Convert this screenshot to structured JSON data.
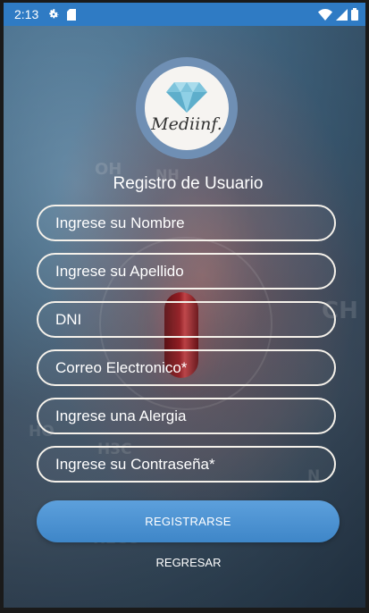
{
  "status_bar": {
    "time": "2:13"
  },
  "logo": {
    "text": "Mediinf."
  },
  "form": {
    "title": "Registro de Usuario",
    "fields": [
      {
        "name": "nombre-field",
        "placeholder": "Ingrese su Nombre",
        "value": ""
      },
      {
        "name": "apellido-field",
        "placeholder": "Ingrese su Apellido",
        "value": ""
      },
      {
        "name": "dni-field",
        "placeholder": "DNI",
        "value": ""
      },
      {
        "name": "email-field",
        "placeholder": "Correo Electronico*",
        "value": ""
      },
      {
        "name": "alergia-field",
        "placeholder": "Ingrese una Alergia",
        "value": ""
      },
      {
        "name": "password-field",
        "placeholder": "Ingrese su Contraseña*",
        "value": ""
      }
    ],
    "register_label": "REGISTRARSE",
    "back_label": "REGRESAR"
  },
  "background_text": [
    "OH",
    "NH",
    "CH",
    "H3C",
    "H2CO",
    "HO",
    "N"
  ],
  "colors": {
    "status_bar": "#2f7bc4",
    "button": "#4a90d0",
    "logo_ring": "#6f8fb4",
    "diamond": "#7ec4dc"
  },
  "icons": {
    "status_left": [
      "gear-icon",
      "sd-card-icon"
    ],
    "status_right": [
      "wifi-icon",
      "signal-icon",
      "battery-icon"
    ]
  }
}
